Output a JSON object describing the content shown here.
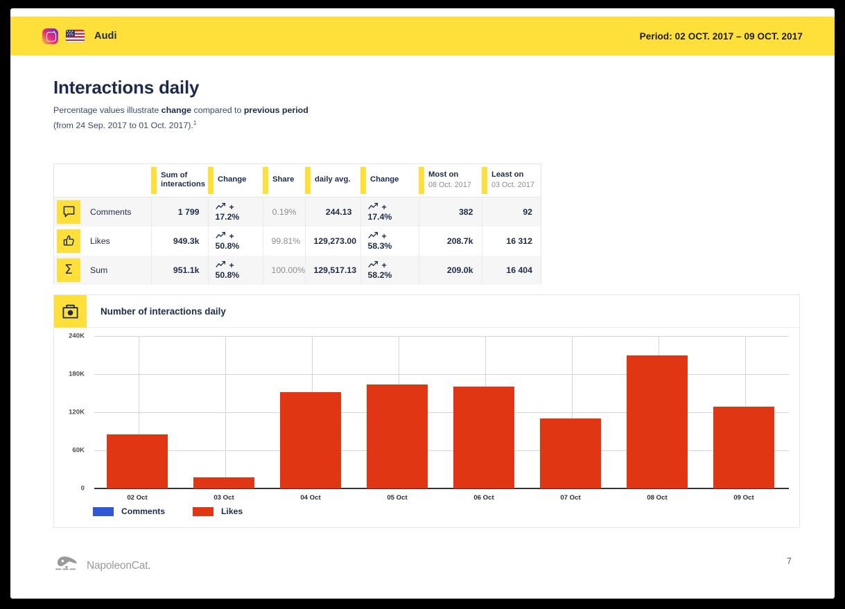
{
  "header": {
    "platform_icon": "instagram-icon",
    "country_icon": "us-flag-icon",
    "profile_name": "Audi",
    "period": "Period: 02 OCT. 2017 – 09 OCT. 2017"
  },
  "page": {
    "title": "Interactions daily",
    "subtitle_line1_a": "Percentage values illustrate ",
    "subtitle_line1_b": "change",
    "subtitle_line1_c": " compared to ",
    "subtitle_line1_d": "previous period",
    "subtitle_line2": "(from 24 Sep. 2017 to 01 Oct. 2017).",
    "subtitle_footnote": "1",
    "page_number": "7"
  },
  "table": {
    "columns": [
      {
        "label": "",
        "sub": ""
      },
      {
        "label": "Sum of interactions",
        "sub": ""
      },
      {
        "label": "Change",
        "sub": ""
      },
      {
        "label": "Share",
        "sub": ""
      },
      {
        "label": "daily avg.",
        "sub": ""
      },
      {
        "label": "Change",
        "sub": ""
      },
      {
        "label": "Most on",
        "sub": "08 Oct. 2017"
      },
      {
        "label": "Least on",
        "sub": "03 Oct. 2017"
      }
    ],
    "rows": [
      {
        "icon": "comment-bubble-icon",
        "icon_glyph": "speech",
        "label": "Comments",
        "sum": "1 799",
        "change1": "+ 17.2%",
        "share": "0.19%",
        "daily_avg": "244.13",
        "change2": "+ 17.4%",
        "most": "382",
        "least": "92"
      },
      {
        "icon": "thumbs-up-icon",
        "icon_glyph": "thumb",
        "label": "Likes",
        "sum": "949.3k",
        "change1": "+ 50.8%",
        "share": "99.81%",
        "daily_avg": "129,273.00",
        "change2": "+ 58.3%",
        "most": "208.7k",
        "least": "16 312"
      },
      {
        "icon": "sigma-sum-icon",
        "icon_glyph": "Σ",
        "label": "Sum",
        "sum": "951.1k",
        "change1": "+ 50.8%",
        "share": "100.00%",
        "daily_avg": "129,517.13",
        "change2": "+ 58.2%",
        "most": "209.0k",
        "least": "16 404"
      }
    ]
  },
  "chart_card": {
    "icon": "interactions-camera-icon",
    "title": "Number of interactions daily"
  },
  "chart_data": {
    "type": "bar",
    "title": "Number of interactions daily",
    "xlabel": "",
    "ylabel": "",
    "categories": [
      "02 Oct",
      "03 Oct",
      "04 Oct",
      "05 Oct",
      "06 Oct",
      "07 Oct",
      "08 Oct",
      "09 Oct"
    ],
    "series": [
      {
        "name": "Comments",
        "color": "#3158D3",
        "values": [
          0,
          0,
          0,
          0,
          0,
          0,
          0,
          0
        ]
      },
      {
        "name": "Likes",
        "color": "#E03613",
        "values": [
          86000,
          18000,
          152000,
          164000,
          161000,
          111000,
          210000,
          129000
        ]
      }
    ],
    "yticks": [
      "0",
      "60K",
      "120K",
      "180K",
      "240K"
    ],
    "ytick_values": [
      0,
      60000,
      120000,
      180000,
      240000
    ],
    "ylim": [
      0,
      240000
    ],
    "grid": true,
    "legend_position": "bottom-left"
  },
  "colors": {
    "brand_yellow": "#FFE03B",
    "likes_red": "#E03613",
    "comments_blue": "#3158D3",
    "dark_navy": "#1D2A4A"
  },
  "footer": {
    "logo_icon": "napoleoncat-logo-icon",
    "brand": "NapoleonCat",
    "brand_dot": "."
  }
}
